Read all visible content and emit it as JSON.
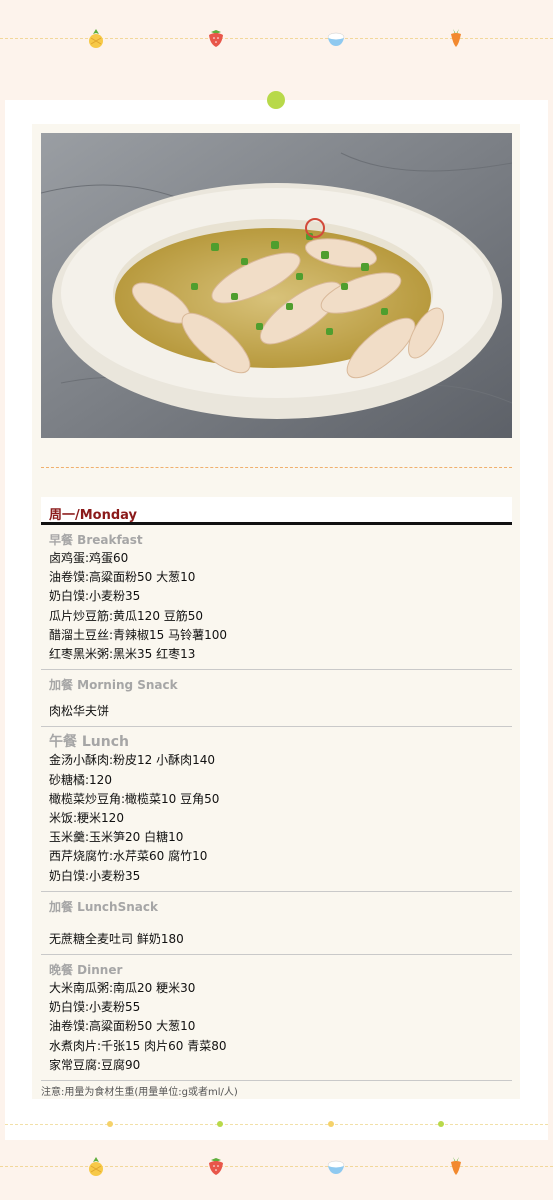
{
  "menu": {
    "day": "周一/Monday",
    "meals": [
      {
        "title": "早餐 Breakfast",
        "items": [
          "卤鸡蛋:鸡蛋60",
          "油卷馍:高粱面粉50 大葱10",
          "奶白馍:小麦粉35",
          "瓜片炒豆筋:黄瓜120 豆筋50",
          "醋溜土豆丝:青辣椒15 马铃薯100",
          "红枣黑米粥:黑米35 红枣13"
        ]
      },
      {
        "title": "加餐 Morning Snack",
        "items": [
          "肉松华夫饼"
        ]
      },
      {
        "title": "午餐 Lunch",
        "items": [
          "金汤小酥肉:粉皮12 小酥肉140",
          "砂糖橘:120",
          "橄榄菜炒豆角:橄榄菜10 豆角50",
          "米饭:粳米120",
          "玉米羹:玉米笋20 白糖10",
          "西芹烧腐竹:水芹菜60 腐竹10",
          "奶白馍:小麦粉35"
        ]
      },
      {
        "title": "加餐 LunchSnack",
        "items": [
          "无蔗糖全麦吐司 鲜奶180"
        ]
      },
      {
        "title": "晚餐 Dinner",
        "items": [
          "大米南瓜粥:南瓜20 粳米30",
          "奶白馍:小麦粉55",
          "油卷馍:高粱面粉50 大葱10",
          "水煮肉片:千张15 肉片60 青菜80",
          "家常豆腐:豆腐90"
        ]
      }
    ]
  },
  "note": "注意:用量为食材生重(用量单位:g或者ml/人)",
  "icons": [
    "pineapple-icon",
    "strawberry-icon",
    "rice-bowl-icon",
    "carrot-icon"
  ],
  "colors": {
    "background": "#fdf3ec",
    "accent": "#8b1a1a",
    "dot": "#b8d94a"
  }
}
